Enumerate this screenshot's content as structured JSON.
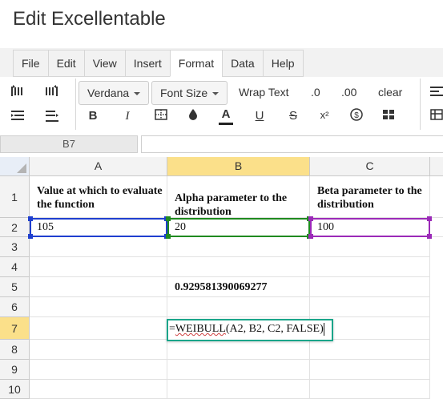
{
  "app": {
    "title": "Edit Excellentable"
  },
  "menu": {
    "tabs": [
      "File",
      "Edit",
      "View",
      "Insert",
      "Format",
      "Data",
      "Help"
    ],
    "active": "Format"
  },
  "toolbar": {
    "font_family": "Verdana",
    "font_size": "Font Size",
    "wrap_text": "Wrap Text",
    "decimal_one": ".0",
    "decimal_two": ".00",
    "clear": "clear",
    "bold": "B",
    "italic": "I",
    "font_color": "A",
    "underline": "U",
    "strikethrough": "S",
    "superscript": "x²",
    "icons": [
      "indent-increase-icon",
      "indent-decrease-icon",
      "align-top-icon",
      "align-bottom-icon",
      "borders-icon",
      "fill-color-icon",
      "currency-icon",
      "merge-cells-icon",
      "align-left-icon",
      "table-icon"
    ]
  },
  "formula_bar": {
    "cell_ref": "B7",
    "value": ""
  },
  "sheet": {
    "columns": [
      "A",
      "B",
      "C"
    ],
    "active_column": "B",
    "rows": [
      "1",
      "2",
      "3",
      "4",
      "5",
      "6",
      "7",
      "8",
      "9",
      "10"
    ],
    "active_row": "7",
    "cells": {
      "A1": "Value at which to evaluate the function",
      "B1": "Alpha parameter to the distribution",
      "C1": "Beta parameter to the distribution",
      "A2": "105",
      "B2": "20",
      "C2": "100",
      "B5": "0.929581390069277"
    },
    "editor": {
      "cell": "B7",
      "prefix": "=",
      "fn": "WEIBULL",
      "args": "(A2, B2, C2, FALSE)"
    },
    "colors": {
      "A2_range": "#1f3fcf",
      "B2_range": "#1f8a1f",
      "C2_range": "#9b2ab8",
      "active_cell": "#1aa58a",
      "active_header": "#fbe08a"
    }
  }
}
